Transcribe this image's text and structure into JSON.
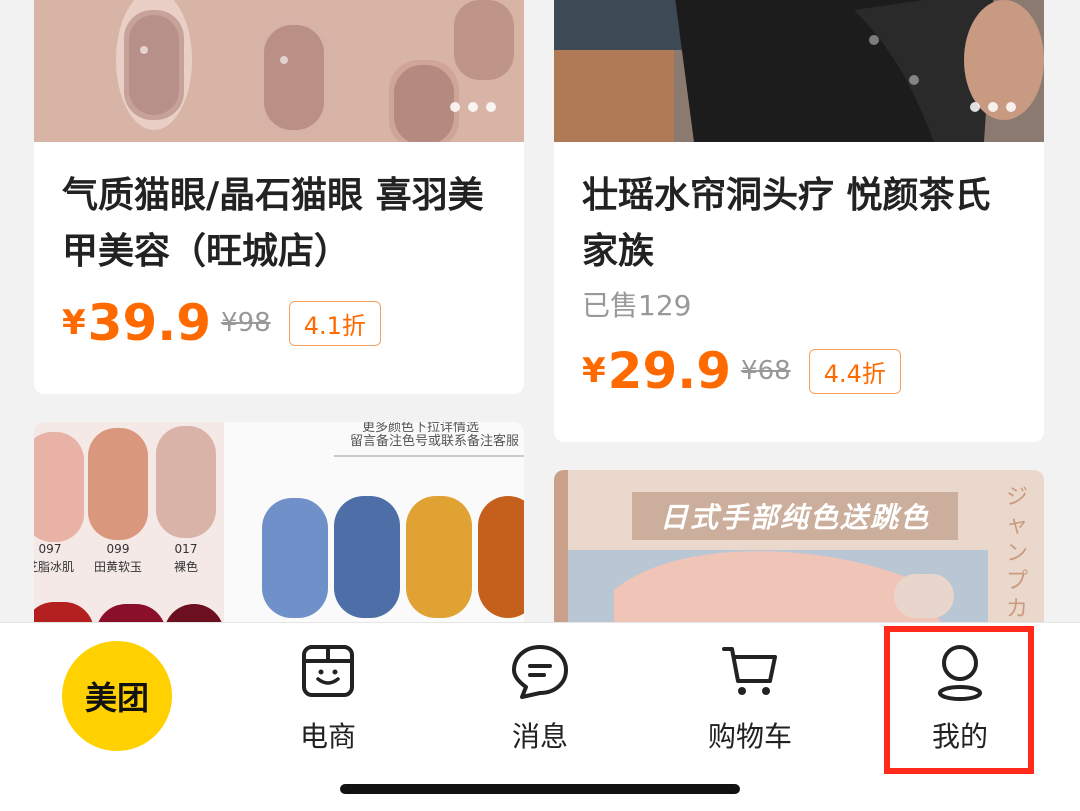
{
  "products": [
    {
      "title": "气质猫眼/晶石猫眼 喜羽美甲美容（旺城店）",
      "currency": "¥",
      "price": "39.9",
      "original_price": "¥98",
      "discount": "4.1折"
    },
    {
      "title": "壮瑶水帘洞头疗 悦颜茶氏家族",
      "sold": "已售129",
      "currency": "¥",
      "price": "29.9",
      "original_price": "¥68",
      "discount": "4.4折"
    }
  ],
  "promo_cards": {
    "swatch_note_1": "更多颜色下拉详情选",
    "swatch_note_2": "留言备注色号或联系备注客服",
    "swatches": [
      {
        "code": "097",
        "name": "芝脂冰肌"
      },
      {
        "code": "099",
        "name": "田黄软玉"
      },
      {
        "code": "017",
        "name": "裸色"
      }
    ],
    "banner": "日式手部纯色送跳色",
    "side_text": "ジャンプカ"
  },
  "tabbar": {
    "logo": "美团",
    "tabs": [
      {
        "label": "电商",
        "icon": "box-smile-icon"
      },
      {
        "label": "消息",
        "icon": "chat-bubble-icon"
      },
      {
        "label": "购物车",
        "icon": "cart-icon"
      },
      {
        "label": "我的",
        "icon": "user-icon"
      }
    ]
  },
  "colors": {
    "accent": "#ff6a00",
    "logo_bg": "#ffd100",
    "highlight": "#ff2a1a"
  }
}
